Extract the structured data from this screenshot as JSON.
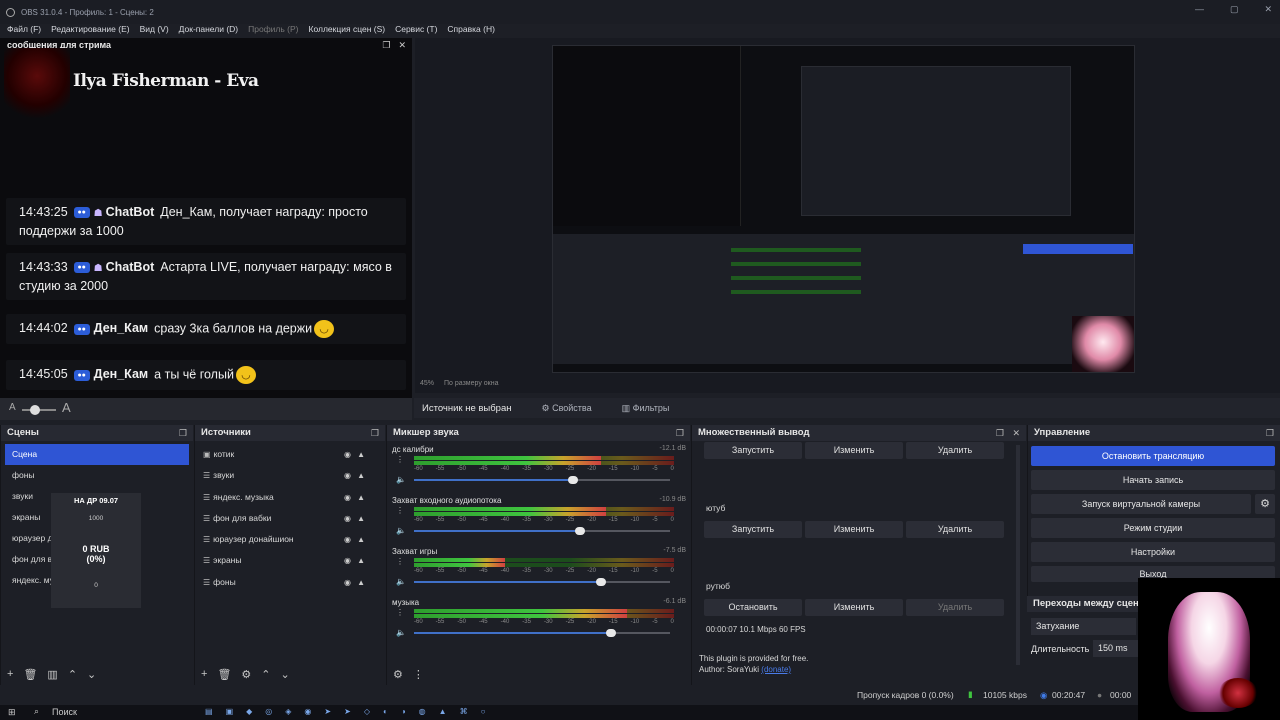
{
  "window": {
    "title": "OBS 31.0.4 - Профиль: 1 - Сцены: 2",
    "controls": [
      "—",
      "▢",
      "✕"
    ]
  },
  "menu": [
    {
      "label": "Файл (F)",
      "disabled": false
    },
    {
      "label": "Редактирование (E)",
      "disabled": false
    },
    {
      "label": "Вид (V)",
      "disabled": false
    },
    {
      "label": "Док-панели (D)",
      "disabled": false
    },
    {
      "label": "Профиль (P)",
      "disabled": true
    },
    {
      "label": "Коллекция сцен (S)",
      "disabled": false
    },
    {
      "label": "Сервис (T)",
      "disabled": false
    },
    {
      "label": "Справка (H)",
      "disabled": false
    }
  ],
  "chat_dock": {
    "title": "сообщения для стрима",
    "song": "Ilya Fisherman - Eva",
    "messages": [
      {
        "time": "14:43:25",
        "user": "ChatBot",
        "bot": true,
        "text": "Ден_Кам, получает награду: просто поддержи за 1000"
      },
      {
        "time": "14:43:33",
        "user": "ChatBot",
        "bot": true,
        "text": "Астарта LIVE, получает награду: мясо в студию за 2000"
      },
      {
        "time": "14:44:02",
        "user": "Ден_Кам",
        "bot": false,
        "text": "сразу 3ка баллов на держи"
      },
      {
        "time": "14:45:05",
        "user": "Ден_Кам",
        "bot": false,
        "text": "а ты чё голый"
      }
    ],
    "font_small": "A",
    "font_large": "A"
  },
  "preview": {
    "zoom": "45%",
    "fit_label": "По размеру окна"
  },
  "context_bar": {
    "no_source": "Источник не выбран",
    "properties": "Свойства",
    "filters": "Фильтры"
  },
  "scenes": {
    "title": "Сцены",
    "items": [
      "Сцена",
      "фоны",
      "звуки",
      "экраны",
      "юраузер д",
      "фон для в",
      "яндекс. му"
    ],
    "selected": 0,
    "widget": {
      "title": "НА ДР 09.07",
      "goal": "1000",
      "amount": "0 RUB",
      "percent": "(0%)",
      "current": "0"
    }
  },
  "sources": {
    "title": "Источники",
    "items": [
      "котик",
      "звуки",
      "яндекс. музыка",
      "фон для вабки",
      "юраузер донайшион",
      "экраны",
      "фоны"
    ]
  },
  "mixer": {
    "title": "Микшер звука",
    "scale": [
      "-60",
      "-55",
      "-50",
      "-45",
      "-40",
      "-35",
      "-30",
      "-25",
      "-20",
      "-15",
      "-10",
      "-5",
      "0"
    ],
    "channels": [
      {
        "name": "дс калибри",
        "db": "-12.1 dB",
        "level": 0.72,
        "fader": 0.62
      },
      {
        "name": "Захват входного аудиопотока",
        "db": "-10.9 dB",
        "level": 0.74,
        "fader": 0.65
      },
      {
        "name": "Захват игры",
        "db": "-7.5 dB",
        "level": 0.35,
        "fader": 0.73
      },
      {
        "name": "музыка",
        "db": "-6.1 dB",
        "level": 0.82,
        "fader": 0.77
      }
    ]
  },
  "multi_output": {
    "title": "Множественный вывод",
    "targets": [
      {
        "name": "",
        "start": "Запустить",
        "edit": "Изменить",
        "delete": "Удалить",
        "delete_disabled": false
      },
      {
        "name": "ютуб",
        "start": "Запустить",
        "edit": "Изменить",
        "delete": "Удалить",
        "delete_disabled": false
      },
      {
        "name": "рутюб",
        "start": "Остановить",
        "edit": "Изменить",
        "delete": "Удалить",
        "delete_disabled": true
      }
    ],
    "stats": "00:00:07  10.1 Mbps  60 FPS",
    "plugin_note": "This plugin is provided for free.",
    "author_label": "Author: SoraYuki",
    "donate": "(donate)"
  },
  "controls": {
    "title": "Управление",
    "buttons": [
      "Остановить трансляцию",
      "Начать запись",
      "Запуск виртуальной камеры",
      "Режим студии",
      "Настройки",
      "Выход"
    ]
  },
  "transitions": {
    "title": "Переходы между сцена",
    "type": "Затухание",
    "duration_label": "Длительность",
    "duration_value": "150 ms"
  },
  "status": {
    "dropped": "Пропуск кадров 0 (0.0%)",
    "bitrate": "10105 kbps",
    "stream_time": "00:20:47",
    "rec_time": "00:00"
  },
  "taskbar": {
    "search": "Поиск"
  },
  "colors": {
    "accent": "#2f55d4",
    "bg": "#1d1f26",
    "dock_header": "#272932"
  }
}
